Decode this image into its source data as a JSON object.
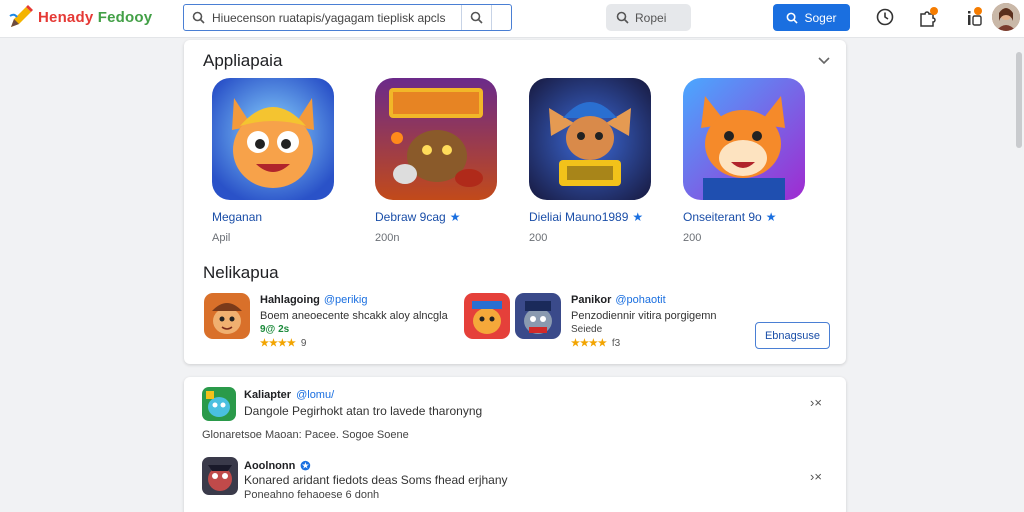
{
  "header": {
    "logo_word1": "Henady",
    "logo_word2": "Fedooy",
    "search_value": "Hiuecenson ruatapis/yagagam tieplisk apcls",
    "secondary_search_label": "Ropei",
    "primary_button_label": "Soger"
  },
  "section1": {
    "title": "Appliapaia",
    "apps": [
      {
        "name": "Meganan",
        "verified": false,
        "sub": "Apil"
      },
      {
        "name": "Debraw 9cag",
        "verified": true,
        "sub": "200n"
      },
      {
        "name": "Dieliai Mauno1989",
        "verified": true,
        "sub": "200"
      },
      {
        "name": "Onseiterant 9o",
        "verified": true,
        "sub": "200"
      }
    ]
  },
  "section2": {
    "title": "Nelikapua",
    "items": [
      {
        "name": "Hahlagoing",
        "tag": "@perikig",
        "desc": "Boem aneoecente shcakk aloy alncgla",
        "version": "9@ 2s",
        "stars": "★★★★",
        "rating": "9"
      },
      {
        "name": "Panikor",
        "tag": "@pohaotit",
        "desc": "Penzodiennir vitira porgigemn",
        "version": "Seiede",
        "stars": "★★★★",
        "rating": "f3"
      }
    ],
    "action_button_label": "Ebnagsuse"
  },
  "list": {
    "items": [
      {
        "name": "Kaliapter",
        "tag": "@lomu/",
        "desc": "Dangole Pegirhokt atan tro lavede tharonyng",
        "sub": "Glonaretsoe Maoan: Pacee. Sogoe Soene"
      },
      {
        "name": "Aoolnonn",
        "tag": "",
        "desc": "Konared aridant fiedots deas Soms fhead erjhany",
        "sub": "Poneahno fehaoese 6 donh"
      }
    ],
    "action_label": "›×"
  },
  "colors": {
    "accent": "#1a6fe0",
    "star": "#f2a400",
    "logo_red": "#e53935",
    "logo_green": "#43a047"
  }
}
